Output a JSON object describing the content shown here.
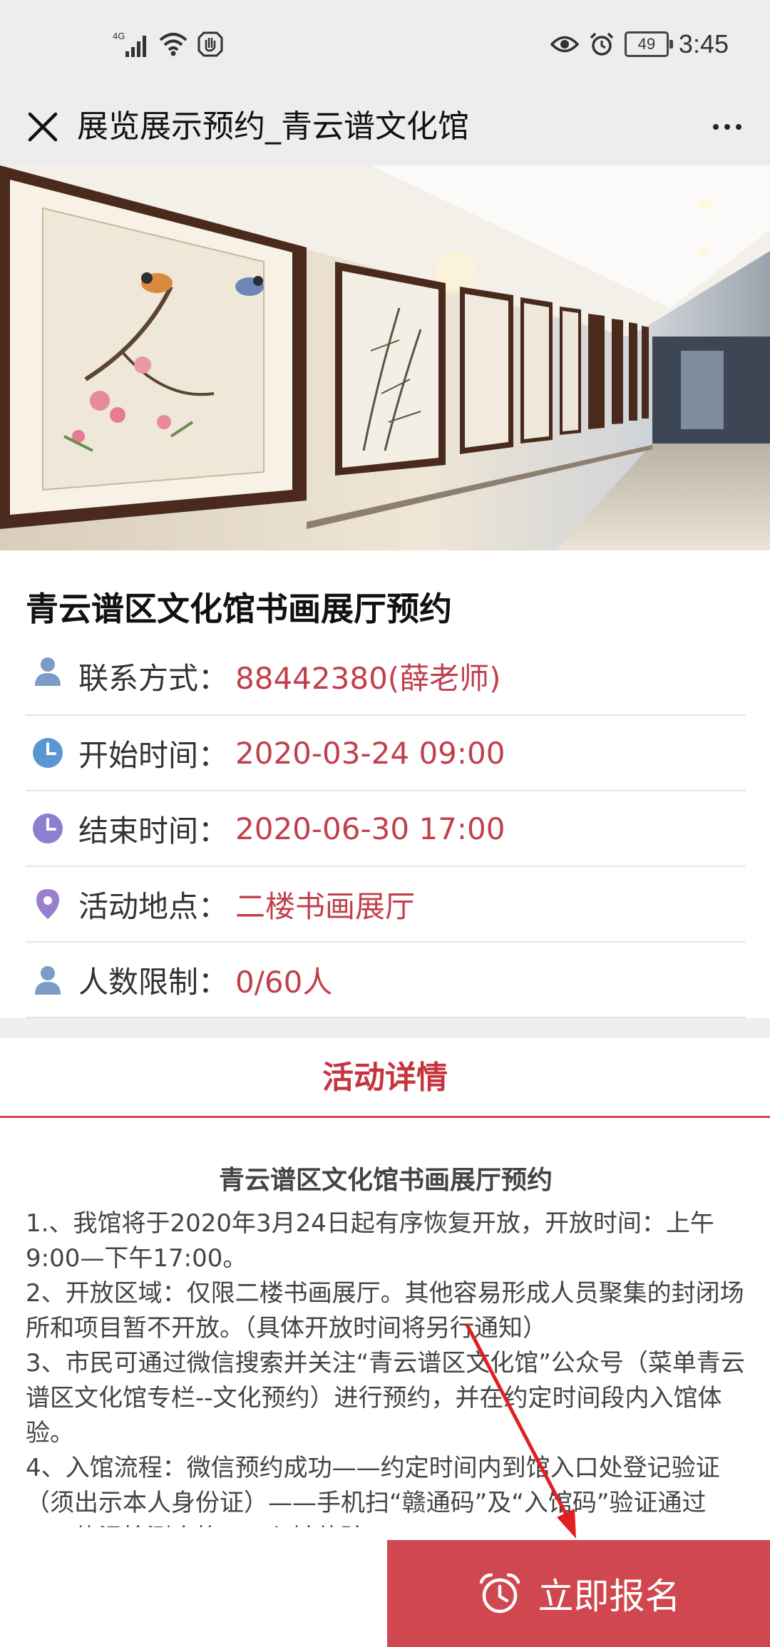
{
  "status_bar": {
    "network": "4G",
    "battery": "49",
    "time": "3:45"
  },
  "nav": {
    "title": "展览展示预约_青云谱文化馆"
  },
  "event": {
    "title": "青云谱区文化馆书画展厅预约",
    "info": [
      {
        "icon": "person-icon",
        "label": "联系方式：",
        "value": "88442380(薛老师)"
      },
      {
        "icon": "clock-icon",
        "label": "开始时间：",
        "value": "2020-03-24 09:00"
      },
      {
        "icon": "clock-icon",
        "label": "结束时间：",
        "value": "2020-06-30 17:00"
      },
      {
        "icon": "location-pin-icon",
        "label": "活动地点：",
        "value": "二楼书画展厅"
      },
      {
        "icon": "person-icon",
        "label": "人数限制：",
        "value": "0/60人"
      }
    ]
  },
  "detail": {
    "heading": "活动详情",
    "article_title": "青云谱区文化馆书画展厅预约",
    "paragraphs": [
      "1.、我馆将于2020年3月24日起有序恢复开放，开放时间：上午9:00—下午17:00。",
      "2、开放区域：仅限二楼书画展厅。其他容易形成人员聚集的封闭场所和项目暂不开放。（具体开放时间将另行通知）",
      "3、市民可通过微信搜索并关注“青云谱区文化馆”公众号（菜单青云谱区文化馆专栏--文化预约）进行预约，并在约定时间段内入馆体验。",
      "4、入馆流程：微信预约成功——约定时间内到馆入口处登记验证（须出示本人身份证）——手机扫“赣通码”及“入馆码”验证通过——体温检测合格——入馆体验。"
    ]
  },
  "action": {
    "signup_label": "立即报名"
  },
  "colors": {
    "accent": "#d0474f",
    "value_text": "#c0404c",
    "bar_bg": "#ededed"
  }
}
